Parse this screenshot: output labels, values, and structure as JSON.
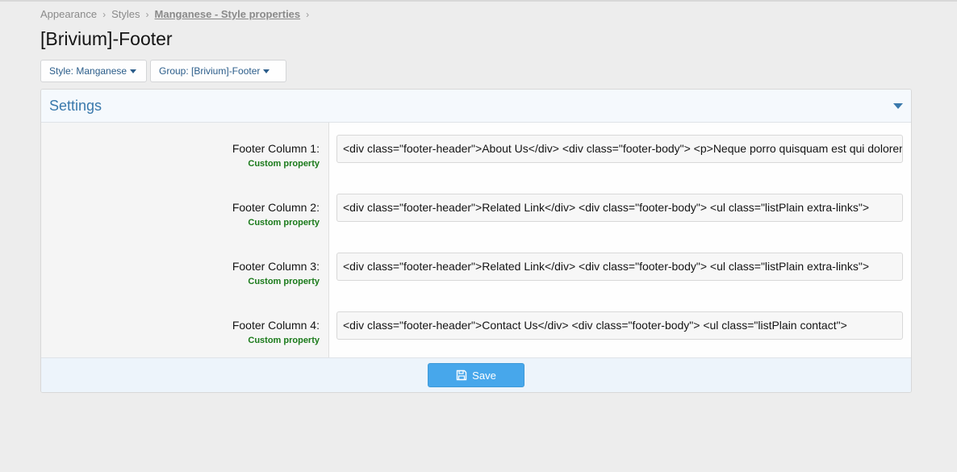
{
  "breadcrumb": {
    "items": [
      "Appearance",
      "Styles",
      "Manganese - Style properties"
    ]
  },
  "page": {
    "title": "[Brivium]-Footer"
  },
  "filters": {
    "style_label": "Style: Manganese",
    "group_label": "Group: [Brivium]-Footer"
  },
  "settings": {
    "title": "Settings",
    "rows": [
      {
        "label": "Footer Column 1:",
        "hint": "Custom property",
        "value": "<div class=\"footer-header\">About Us</div>   <div class=\"footer-body\">   <p>Neque porro quisquam est qui dolorem ipsum"
      },
      {
        "label": "Footer Column 2:",
        "hint": "Custom property",
        "value": "<div class=\"footer-header\">Related Link</div>   <div class=\"footer-body\">       <ul class=\"listPlain extra-links\">"
      },
      {
        "label": "Footer Column 3:",
        "hint": "Custom property",
        "value": "<div class=\"footer-header\">Related Link</div>   <div class=\"footer-body\">       <ul class=\"listPlain extra-links\">"
      },
      {
        "label": "Footer Column 4:",
        "hint": "Custom property",
        "value": "<div class=\"footer-header\">Contact Us</div>   <div class=\"footer-body\">        <ul class=\"listPlain contact\">"
      }
    ],
    "save_label": "Save"
  },
  "colors": {
    "accent": "#47a7eb",
    "link": "#2b5d8a",
    "hint_green": "#1a7a1a"
  },
  "icons": {
    "breadcrumb_separator": "chevron-right-icon",
    "dropdown": "caret-down-icon",
    "collapse": "collapse-toggle-icon",
    "save": "floppy-disk-icon"
  }
}
